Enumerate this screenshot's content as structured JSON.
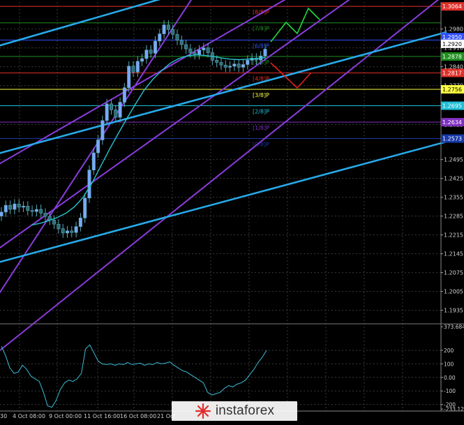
{
  "chart_data": [
    {
      "type": "candlestick",
      "instrument_note": "",
      "y_ticks": [
        "1.2980",
        "1.2910",
        "1.2840",
        "1.2770",
        "1.2625",
        "1.2495",
        "1.2425",
        "1.2355",
        "1.2285",
        "1.2215",
        "1.2145",
        "1.2075",
        "1.2005",
        "1.1935"
      ],
      "x_ticks": [
        "30",
        "4 Oct 08:00",
        "9 Oct 00:00",
        "11 Oct 16:00",
        "16 Oct 08:00",
        "21 Oct"
      ],
      "ylim": [
        1.189,
        1.308
      ],
      "price_labels": [
        {
          "text": "1.3064",
          "value": 1.3064,
          "color": "#e0302a"
        },
        {
          "text": "1.2939",
          "value": 1.2939,
          "color": "#1f8f1f"
        },
        {
          "text": "1.2950",
          "value": 1.295,
          "color": "#3050ff"
        },
        {
          "text": "1.2920",
          "value": 1.2925,
          "color": "#ffffff"
        },
        {
          "text": "1.2878",
          "value": 1.2878,
          "color": "#1f8f1f"
        },
        {
          "text": "1.2817",
          "value": 1.2817,
          "color": "#e0302a"
        },
        {
          "text": "1.2756",
          "value": 1.2756,
          "color": "#ffff40"
        },
        {
          "text": "1.2695",
          "value": 1.2695,
          "color": "#20c0d8"
        },
        {
          "text": "1.2634",
          "value": 1.2634,
          "color": "#8030c0"
        },
        {
          "text": "1.2573",
          "value": 1.2573,
          "color": "#1838a8"
        }
      ],
      "murrey_levels": [
        {
          "label": "[8/8]P",
          "value": 1.3064,
          "color": "#e0302a"
        },
        {
          "label": "[7/8]P",
          "value": 1.3003,
          "color": "#1f8f1f"
        },
        {
          "label": "[6/8]P",
          "value": 1.2939,
          "color": "#3050ff"
        },
        {
          "label": "[5/8]P",
          "value": 1.2878,
          "color": "#1f8f1f"
        },
        {
          "label": "[4/8]P",
          "value": 1.2817,
          "color": "#e0302a"
        },
        {
          "label": "[3/8]P",
          "value": 1.2756,
          "color": "#ffff40"
        },
        {
          "label": "[2/8]P",
          "value": 1.2695,
          "color": "#20c0d8"
        },
        {
          "label": "[1/8]P",
          "value": 1.2634,
          "color": "#8030c0"
        },
        {
          "label": "[0/8]P",
          "value": 1.2573,
          "color": "#1838a8"
        }
      ],
      "series": [
        {
          "close": [
            1.23,
            1.2325,
            1.231,
            1.233,
            1.2318,
            1.2322,
            1.2306,
            1.2302,
            1.231,
            1.2296,
            1.2284,
            1.227,
            1.2255,
            1.2238,
            1.2222,
            1.223,
            1.2224,
            1.2246,
            1.2278,
            1.2352,
            1.2456,
            1.252,
            1.2568,
            1.264,
            1.2702,
            1.268,
            1.2652,
            1.2708,
            1.2762,
            1.2842,
            1.282,
            1.286,
            1.287,
            1.2902,
            1.289,
            1.2935,
            1.2962,
            1.2995,
            1.2978,
            1.296,
            1.2938,
            1.2922,
            1.2906,
            1.2892,
            1.2885,
            1.2902,
            1.291,
            1.2892,
            1.2864,
            1.2856,
            1.2846,
            1.2838,
            1.2842,
            1.285,
            1.2838,
            1.2848,
            1.2864,
            1.2872,
            1.2865,
            1.288,
            1.2905
          ]
        },
        {
          "values": [
            1.2252,
            1.2258,
            1.2268,
            1.228,
            1.2296,
            1.232,
            1.2356,
            1.2408,
            1.247,
            1.2532,
            1.259,
            1.2646,
            1.27,
            1.2752,
            1.2792,
            1.2824,
            1.2852,
            1.287,
            1.288,
            1.2884,
            1.2882,
            1.2878,
            1.2872,
            1.2868,
            1.2866,
            1.2868,
            1.287,
            1.2874
          ]
        }
      ]
    },
    {
      "type": "line",
      "y_ticks": [
        "373.6844",
        "200",
        "100",
        "0.00",
        "-100",
        "-200",
        "-233.124"
      ],
      "ylim": [
        -248,
        385
      ],
      "levels": [
        200,
        100,
        0,
        -100,
        -200
      ],
      "series": [
        {
          "values": [
            230,
            160,
            70,
            30,
            40,
            90,
            60,
            10,
            -10,
            -30,
            -110,
            -210,
            -220,
            -170,
            -90,
            -40,
            -20,
            -30,
            -10,
            30,
            210,
            240,
            180,
            120,
            100,
            95,
            100,
            90,
            100,
            95,
            110,
            95,
            100,
            105,
            90,
            100,
            95,
            110,
            100,
            105,
            115,
            90,
            70,
            50,
            40,
            20,
            0,
            -20,
            -40,
            -110,
            -130,
            -120,
            -110,
            -80,
            -60,
            -70,
            -50,
            -40,
            -20,
            20,
            60,
            110,
            150,
            200
          ]
        }
      ]
    }
  ],
  "watermark": {
    "text": "instaforex"
  }
}
